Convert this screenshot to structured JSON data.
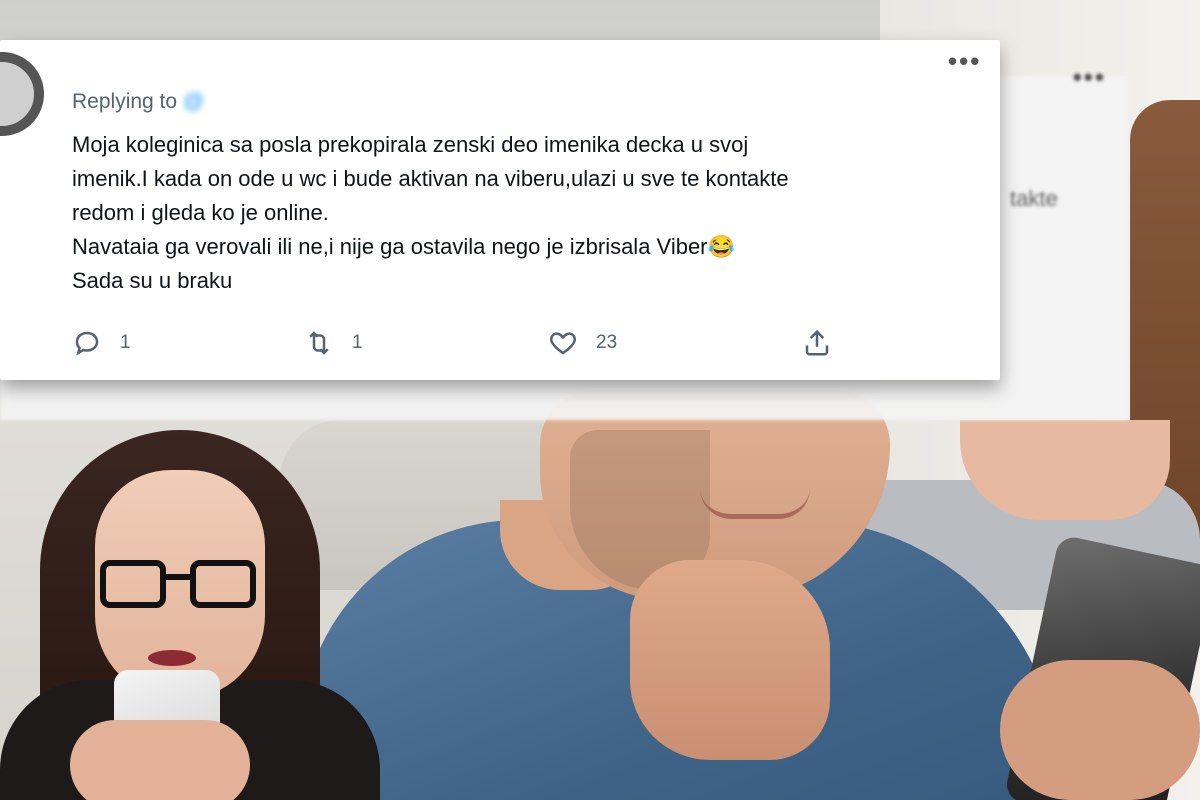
{
  "tweet": {
    "author_name_obscured": "",
    "reply_prefix": "Replying to",
    "reply_handle": "@",
    "lines": [
      "Moja koleginica sa posla prekopirala zenski deo imenika decka u svoj",
      "imenik.I kada on ode u wc i bude aktivan na viberu,ulazi u sve te kontakte",
      "redom i gleda ko je online.",
      "Navataia ga verovali ili ne,i nije ga ostavila nego je izbrisala Viber",
      "Sada su u braku"
    ],
    "emoji": "😂",
    "more_label": "•••",
    "actions": {
      "reply_count": "1",
      "retweet_count": "1",
      "like_count": "23",
      "reply_icon": "reply-icon",
      "retweet_icon": "retweet-icon",
      "like_icon": "heart-icon",
      "share_icon": "share-icon"
    }
  },
  "back_tweet": {
    "more_label": "•••",
    "partial_text": "takte"
  },
  "colors": {
    "text": "#0f1419",
    "muted": "#536471",
    "link": "#1d9bf0",
    "card": "#ffffff"
  }
}
